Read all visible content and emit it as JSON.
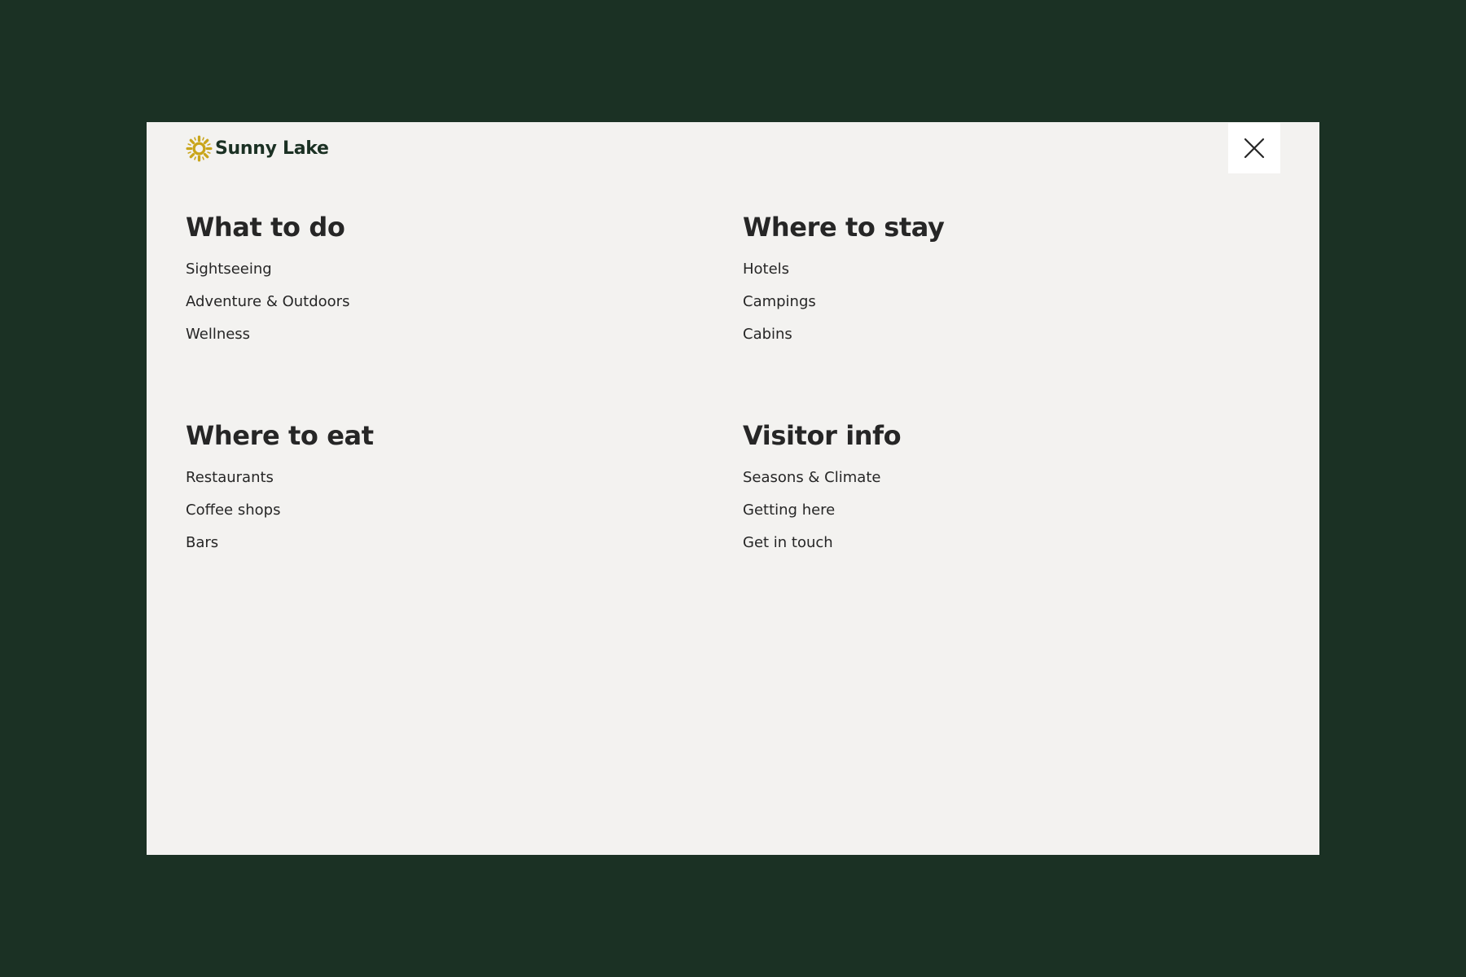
{
  "colors": {
    "background": "#1b3124",
    "panel": "#f3f2f0",
    "brand_text": "#1b3124",
    "sun_accent": "#c9a51a",
    "text": "#262626",
    "close_button_bg": "#ffffff"
  },
  "header": {
    "logo_text": "Sunny Lake",
    "logo_icon": "sun-icon",
    "close_icon": "close-icon"
  },
  "menu": {
    "sections": [
      {
        "title": "What to do",
        "links": [
          "Sightseeing",
          "Adventure & Outdoors",
          "Wellness"
        ]
      },
      {
        "title": "Where to stay",
        "links": [
          "Hotels",
          "Campings",
          "Cabins"
        ]
      },
      {
        "title": "Where to eat",
        "links": [
          "Restaurants",
          "Coffee shops",
          "Bars"
        ]
      },
      {
        "title": "Visitor info",
        "links": [
          "Seasons & Climate",
          "Getting here",
          "Get in touch"
        ]
      }
    ]
  }
}
